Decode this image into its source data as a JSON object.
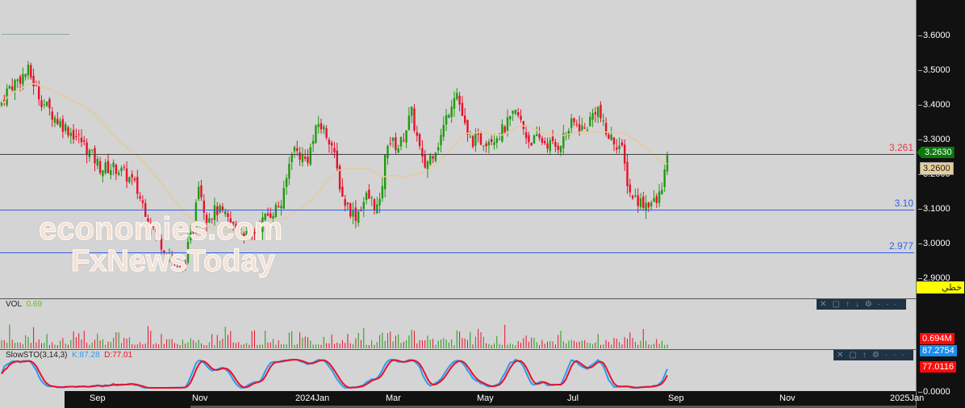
{
  "chart_data": {
    "type": "candlestick",
    "title": "",
    "x_months": [
      "Sep",
      "Nov",
      "2024Jan",
      "Mar",
      "May",
      "Jul",
      "Sep",
      "Nov",
      "2025Jan"
    ],
    "y_ticks": [
      "3.6000",
      "3.5000",
      "3.4000",
      "3.3000",
      "3.2000",
      "3.1000",
      "3.0000",
      "2.9000"
    ],
    "ylim": [
      2.87,
      3.67
    ],
    "price_path": [
      [
        0,
        3.4
      ],
      [
        10,
        3.45
      ],
      [
        35,
        3.5
      ],
      [
        50,
        3.42
      ],
      [
        70,
        3.36
      ],
      [
        100,
        3.3
      ],
      [
        125,
        3.22
      ],
      [
        145,
        3.22
      ],
      [
        165,
        3.18
      ],
      [
        195,
        3.02
      ],
      [
        215,
        2.95
      ],
      [
        225,
        2.92
      ],
      [
        240,
        3.05
      ],
      [
        245,
        3.2
      ],
      [
        255,
        3.08
      ],
      [
        270,
        3.1
      ],
      [
        290,
        3.05
      ],
      [
        310,
        3.02
      ],
      [
        330,
        3.08
      ],
      [
        350,
        3.12
      ],
      [
        362,
        3.28
      ],
      [
        380,
        3.24
      ],
      [
        395,
        3.35
      ],
      [
        410,
        3.3
      ],
      [
        425,
        3.13
      ],
      [
        440,
        3.08
      ],
      [
        455,
        3.14
      ],
      [
        470,
        3.1
      ],
      [
        480,
        3.3
      ],
      [
        495,
        3.28
      ],
      [
        510,
        3.38
      ],
      [
        525,
        3.22
      ],
      [
        545,
        3.3
      ],
      [
        555,
        3.38
      ],
      [
        565,
        3.45
      ],
      [
        580,
        3.3
      ],
      [
        600,
        3.3
      ],
      [
        620,
        3.32
      ],
      [
        640,
        3.38
      ],
      [
        655,
        3.3
      ],
      [
        670,
        3.3
      ],
      [
        690,
        3.28
      ],
      [
        710,
        3.35
      ],
      [
        725,
        3.33
      ],
      [
        740,
        3.4
      ],
      [
        750,
        3.32
      ],
      [
        770,
        3.28
      ],
      [
        780,
        3.15
      ],
      [
        795,
        3.12
      ],
      [
        815,
        3.12
      ],
      [
        825,
        3.22
      ],
      [
        830,
        3.263
      ]
    ],
    "levels": [
      {
        "value": 3.261,
        "label": "3.261",
        "color": "#e8364a"
      },
      {
        "value": 3.1,
        "label": "3.10",
        "color": "#2f5fe8"
      },
      {
        "value": 2.977,
        "label": "2.977",
        "color": "#2f5fe8"
      }
    ],
    "last_price": "3.2630",
    "ma_price": "3.2600",
    "chart_type_label": "خطي",
    "volume": {
      "label": "VOL",
      "value": "0.69",
      "axis_value": "0.694M"
    },
    "stoch": {
      "label": "SlowSTO(3,14,3)",
      "k_label": "K:87.28",
      "d_label": "D:77.01",
      "k_axis": "87.2754",
      "d_axis": "77.0116",
      "zero": "0.0000"
    }
  },
  "watermark": {
    "line1": "economies.com",
    "line2": "FxNewsToday"
  },
  "colors": {
    "up": "#1f9a10",
    "down": "#e8102a",
    "ma": "#e8c99a"
  }
}
